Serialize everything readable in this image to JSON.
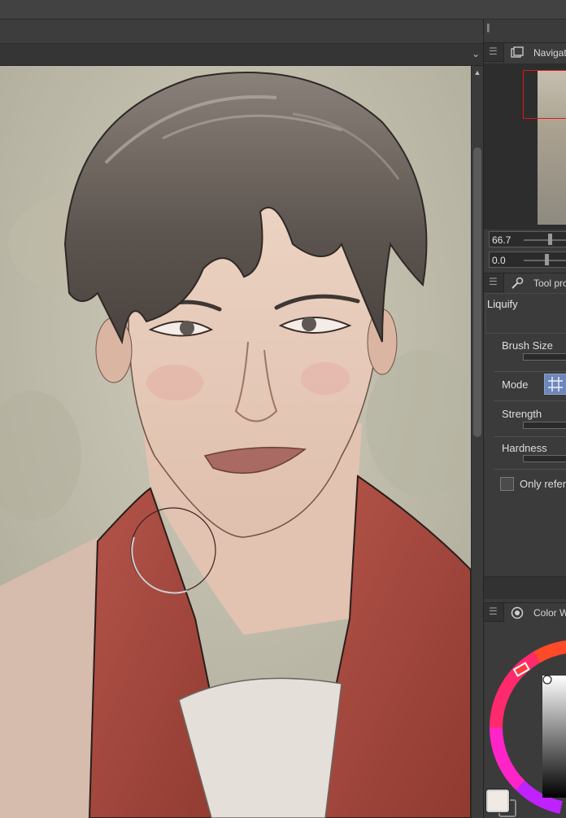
{
  "navigator": {
    "title": "Navigat",
    "zoom_value": "66.7",
    "rotate_value": "0.0"
  },
  "tool_property": {
    "title": "Tool pro",
    "tool_name": "Liquify",
    "brush_size_label": "Brush Size",
    "mode_label": "Mode",
    "strength_label": "Strength",
    "hardness_label": "Hardness",
    "only_reference_label": "Only refer"
  },
  "color_wheel": {
    "title": "Color W"
  },
  "colors": {
    "panel_bg": "#3b3b3b",
    "mode_button": "#6f87b8",
    "nav_frame": "#e01818",
    "shirt": "#a8483a",
    "hair": "#5a524c",
    "skin": "#e6c9b8"
  }
}
